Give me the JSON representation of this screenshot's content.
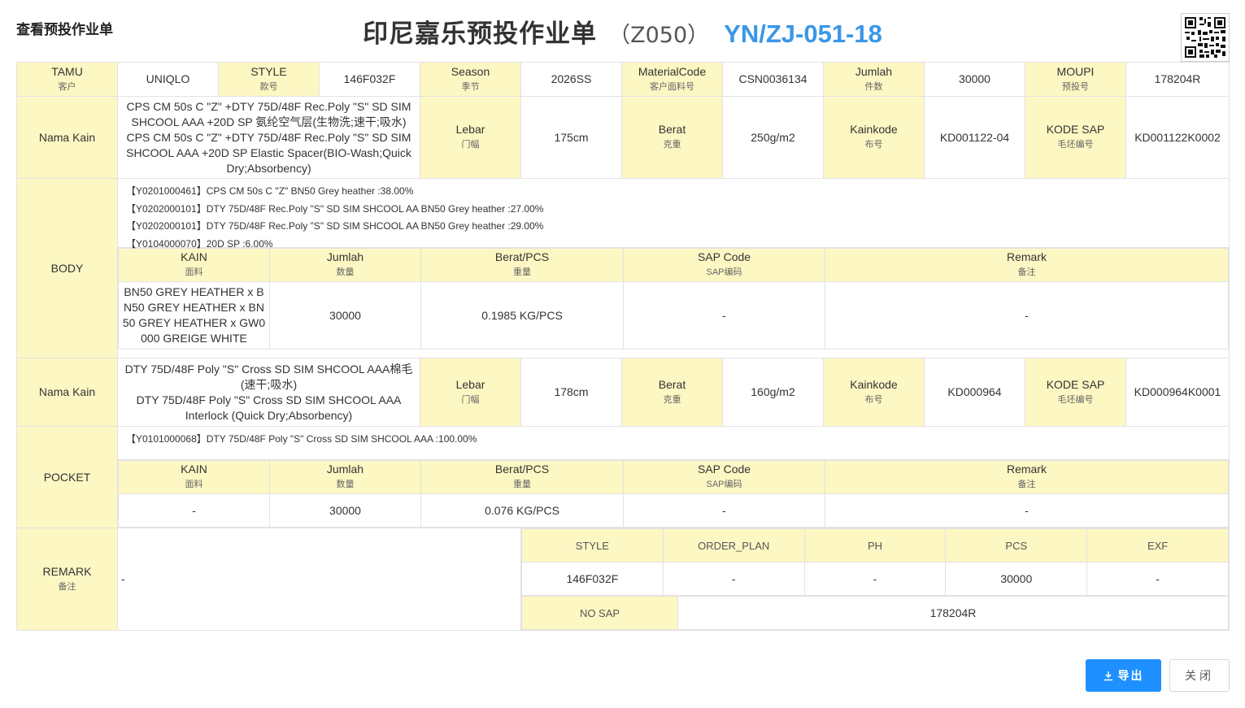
{
  "header": {
    "dialog_title": "查看预投作业单",
    "title_cn": "印尼嘉乐预投作业单",
    "title_code": "（Z050）",
    "title_no": "YN/ZJ-051-18"
  },
  "info": {
    "tamu_label": "TAMU",
    "tamu_cn": "客户",
    "tamu_value": "UNIQLO",
    "style_label": "STYLE",
    "style_cn": "款号",
    "style_value": "146F032F",
    "season_label": "Season",
    "season_cn": "季节",
    "season_value": "2026SS",
    "material_label": "MaterialCode",
    "material_cn": "客户面料号",
    "material_value": "CSN0036134",
    "jumlah_label": "Jumlah",
    "jumlah_cn": "件数",
    "jumlah_value": "30000",
    "moupi_label": "MOUPI",
    "moupi_cn": "预投号",
    "moupi_value": "178204R"
  },
  "labels": {
    "nama_kain": "Nama Kain",
    "lebar": "Lebar",
    "lebar_cn": "门幅",
    "berat": "Berat",
    "berat_cn": "克重",
    "kainkode": "Kainkode",
    "kainkode_cn": "布号",
    "kode_sap": "KODE SAP",
    "kode_sap_cn": "毛坯编号",
    "kain": "KAIN",
    "kain_cn": "面料",
    "jumlah": "Jumlah",
    "jumlah_cn": "数量",
    "berat_pcs": "Berat/PCS",
    "berat_pcs_cn": "重量",
    "sap_code": "SAP Code",
    "sap_code_cn": "SAP编码",
    "remark": "Remark",
    "remark_cn": "备注",
    "remark_upper": "REMARK",
    "remark_upper_cn": "备注"
  },
  "body": {
    "section_label": "BODY",
    "fabric_name": "CPS CM 50s C \"Z\" +DTY 75D/48F Rec.Poly \"S\" SD SIM SHCOOL AAA +20D SP 氨纶空气层(生物洗;速干;吸水)\nCPS CM 50s C \"Z\" +DTY 75D/48F Rec.Poly \"S\" SD SIM SHCOOL AAA +20D SP Elastic Spacer(BIO-Wash;Quick Dry;Absorbency)",
    "lebar": "175cm",
    "berat": "250g/m2",
    "kainkode": "KD001122-04",
    "kode_sap": "KD001122K0002",
    "composition": [
      "【Y0201000461】CPS CM 50s C \"Z\" BN50 Grey heather :38.00%",
      "【Y0202000101】DTY 75D/48F Rec.Poly \"S\" SD SIM SHCOOL AA BN50 Grey heather :27.00%",
      "【Y0202000101】DTY 75D/48F Rec.Poly \"S\" SD SIM SHCOOL AA BN50 Grey heather :29.00%",
      "【Y0104000070】20D SP :6.00%"
    ],
    "row": {
      "kain": "BN50 GREY HEATHER x BN50 GREY HEATHER x BN50 GREY HEATHER x GW0000 GREIGE WHITE",
      "jumlah": "30000",
      "berat_pcs": "0.1985 KG/PCS",
      "sap_code": "-",
      "remark": "-"
    }
  },
  "pocket": {
    "section_label": "POCKET",
    "fabric_name": "DTY 75D/48F Poly \"S\" Cross SD SIM SHCOOL AAA棉毛(速干;吸水)\nDTY 75D/48F Poly \"S\" Cross SD SIM SHCOOL AAA Interlock (Quick Dry;Absorbency)",
    "lebar": "178cm",
    "berat": "160g/m2",
    "kainkode": "KD000964",
    "kode_sap": "KD000964K0001",
    "composition": [
      "【Y0101000068】DTY 75D/48F Poly \"S\" Cross SD SIM SHCOOL AAA :100.00%"
    ],
    "row": {
      "kain": "-",
      "jumlah": "30000",
      "berat_pcs": "0.076 KG/PCS",
      "sap_code": "-",
      "remark": "-"
    }
  },
  "remark": {
    "text": "-",
    "headers": [
      "STYLE",
      "ORDER_PLAN",
      "PH",
      "PCS",
      "EXF"
    ],
    "values": [
      "146F032F",
      "-",
      "-",
      "30000",
      "-"
    ],
    "no_sap_label": "NO SAP",
    "no_sap_value": "178204R"
  },
  "buttons": {
    "export_label": "导出",
    "close_label": "关闭"
  },
  "colors": {
    "accent": "#1e90ff",
    "title_no": "#3a97e8",
    "label_bg": "#fdf7c3"
  }
}
